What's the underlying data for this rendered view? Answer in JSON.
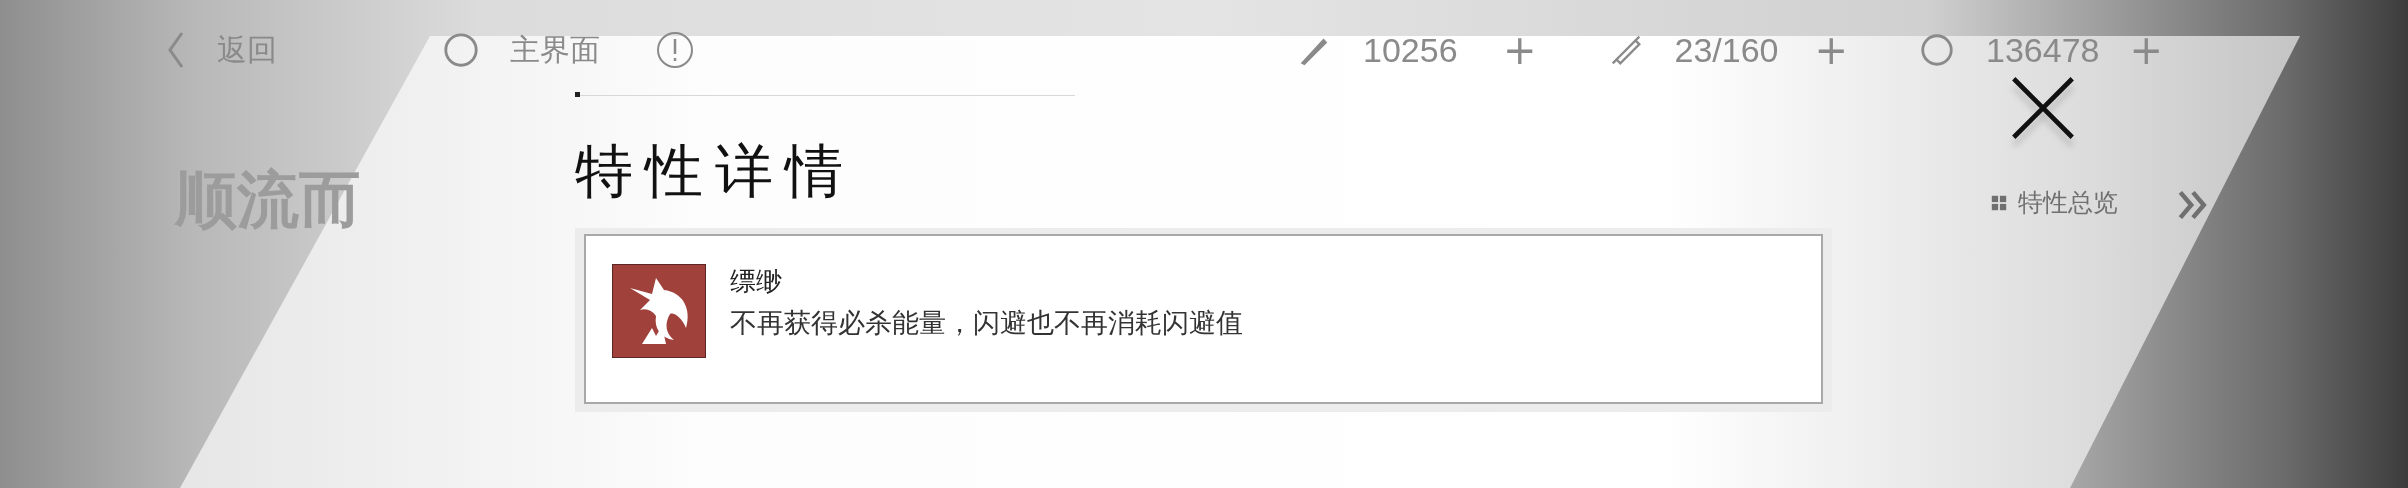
{
  "top_bar": {
    "back_label": "返回",
    "home_label": "主界面",
    "resources": [
      {
        "kind": "pen",
        "value": "10256",
        "add": "+"
      },
      {
        "kind": "syringe",
        "value": "23/160",
        "add": "+"
      },
      {
        "kind": "coin",
        "value": "136478",
        "add": "+"
      }
    ]
  },
  "background_title": "顺流而",
  "overview_link": "特性总览",
  "dialog": {
    "title": "特性详情",
    "traits": [
      {
        "name": "缥缈",
        "description": "不再获得必杀能量，闪避也不再消耗闪避值"
      }
    ]
  }
}
